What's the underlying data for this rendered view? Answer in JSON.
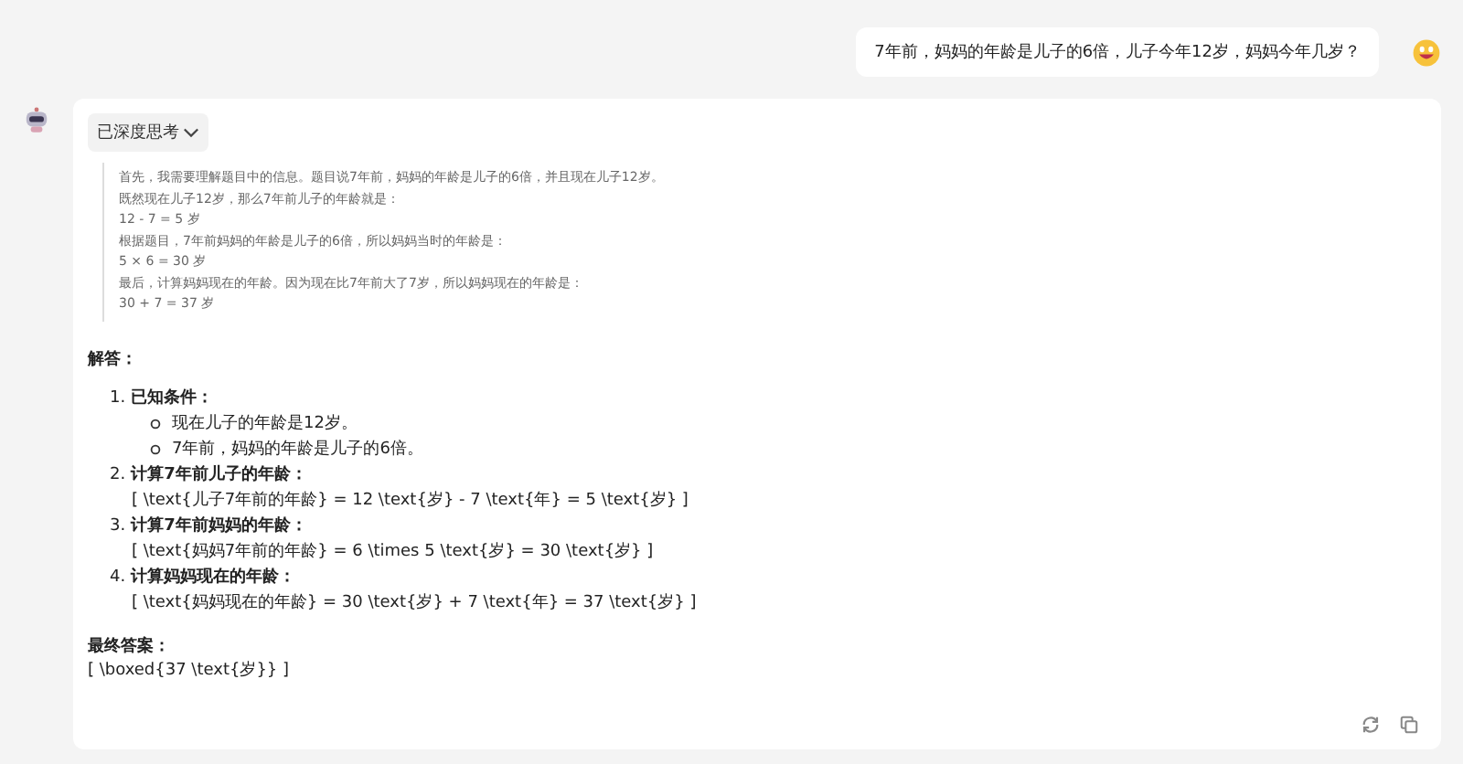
{
  "user_message": "7年前，妈妈的年龄是儿子的6倍，儿子今年12岁，妈妈今年几岁？",
  "thinking": {
    "label": "已深度思考",
    "expanded": true,
    "lines": [
      "首先，我需要理解题目中的信息。题目说7年前，妈妈的年龄是儿子的6倍，并且现在儿子12岁。",
      "既然现在儿子12岁，那么7年前儿子的年龄就是：",
      "12 - 7 = 5 岁",
      "根据题目，7年前妈妈的年龄是儿子的6倍，所以妈妈当时的年龄是：",
      "5 × 6 = 30 岁",
      "最后，计算妈妈现在的年龄。因为现在比7年前大了7岁，所以妈妈现在的年龄是：",
      "30 + 7 = 37 岁"
    ]
  },
  "answer": {
    "heading": "解答：",
    "steps": [
      {
        "number": "1.",
        "title": "已知条件：",
        "bullets": [
          "现在儿子的年龄是12岁。",
          "7年前，妈妈的年龄是儿子的6倍。"
        ]
      },
      {
        "number": "2.",
        "title": "计算7年前儿子的年龄：",
        "formula": "[ \\text{儿子7年前的年龄} = 12 \\text{岁} - 7 \\text{年} = 5 \\text{岁} ]"
      },
      {
        "number": "3.",
        "title": "计算7年前妈妈的年龄：",
        "formula": "[ \\text{妈妈7年前的年龄} = 6 \\times 5 \\text{岁} = 30 \\text{岁} ]"
      },
      {
        "number": "4.",
        "title": "计算妈妈现在的年龄：",
        "formula": "[ \\text{妈妈现在的年龄} = 30 \\text{岁} + 7 \\text{年} = 37 \\text{岁} ]"
      }
    ],
    "final_heading": "最终答案：",
    "final": "[ \\boxed{37 \\text{岁}} ]"
  }
}
